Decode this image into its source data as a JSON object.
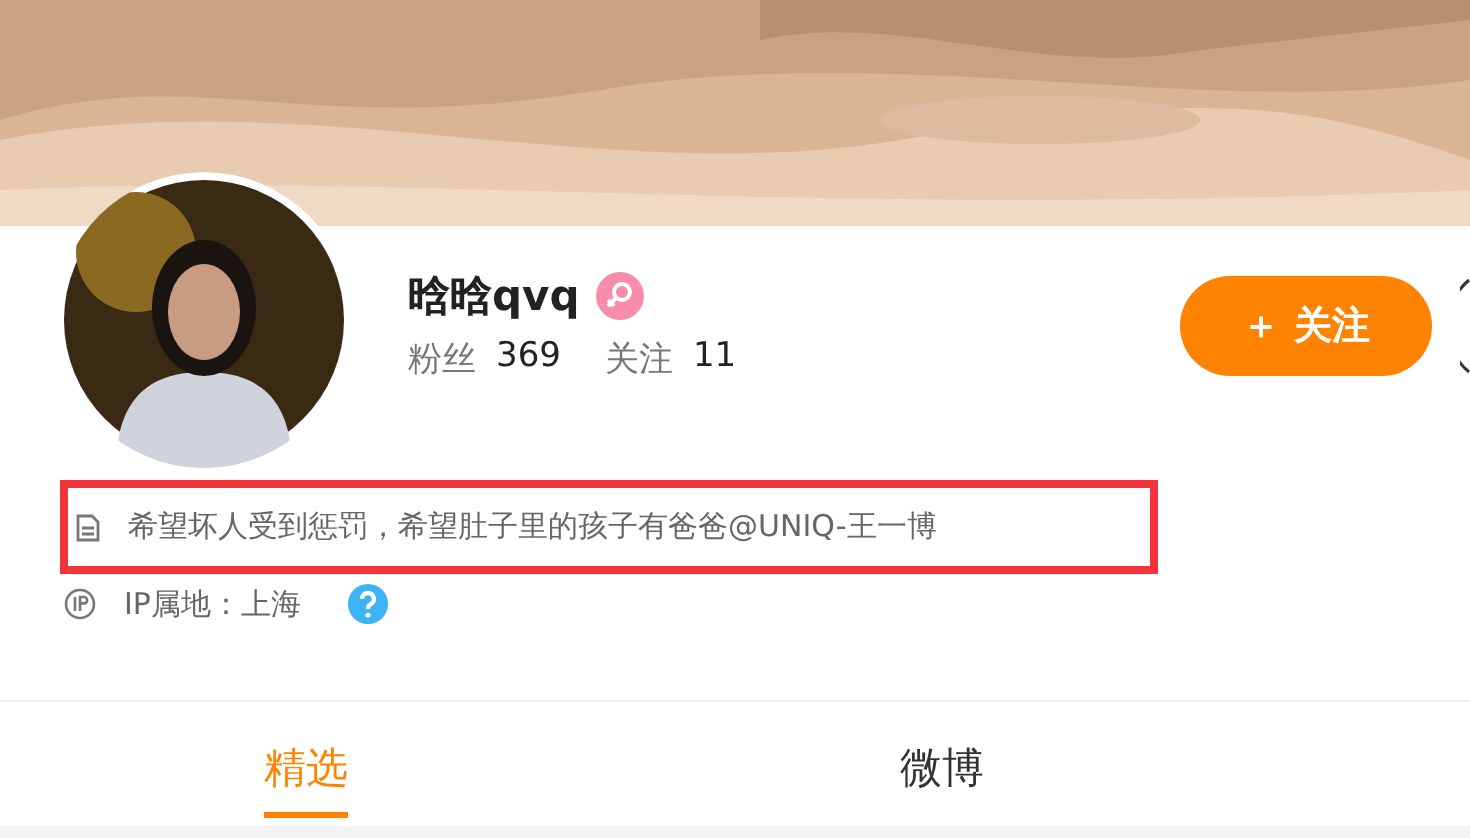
{
  "profile": {
    "name": "晗晗qvq",
    "female": true,
    "stats": [
      {
        "label": "粉丝",
        "value": "369"
      },
      {
        "label": "关注",
        "value": "11"
      }
    ],
    "follow_button": "＋ 关注",
    "bio": "希望坏人受到惩罚，希望肚子里的孩子有爸爸@UNIQ-王一博",
    "bio_highlighted": true,
    "ip_location": "IP属地：上海"
  },
  "tabs": [
    {
      "label": "精选",
      "selected": true
    },
    {
      "label": "微博",
      "selected": false
    }
  ]
}
